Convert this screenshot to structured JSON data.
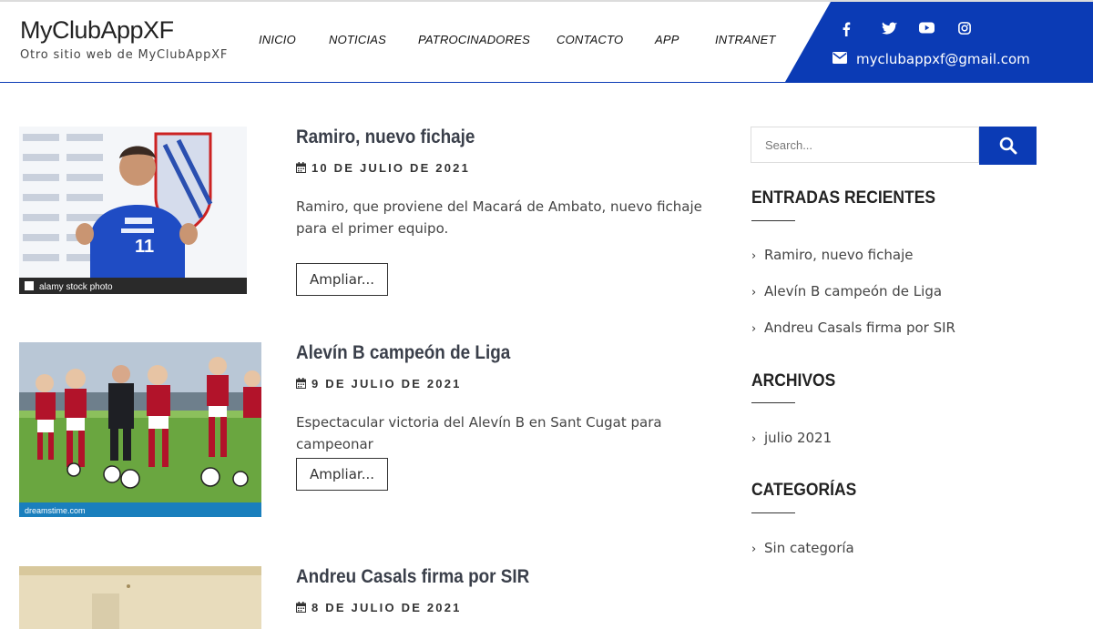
{
  "site": {
    "title": "MyClubAppXF",
    "tagline": "Otro sitio web de MyClubAppXF"
  },
  "nav": [
    "INICIO",
    "NOTICIAS",
    "PATROCINADORES",
    "CONTACTO",
    "APP",
    "INTRANET"
  ],
  "social": [
    "facebook-icon",
    "twitter-icon",
    "youtube-icon",
    "instagram-icon"
  ],
  "contact": {
    "email": "myclubappxf@gmail.com"
  },
  "colors": {
    "brand_blue": "#0b3bb5"
  },
  "posts": [
    {
      "title": "Ramiro, nuevo fichaje",
      "date": "10 DE JULIO DE 2021",
      "excerpt": "Ramiro, que proviene del Macará de Ambato, nuevo fichaje para el primer equipo.",
      "button": "Ampliar...",
      "image_caption": "alamy stock photo"
    },
    {
      "title": "Alevín B campeón de Liga",
      "date": "9 DE JULIO DE 2021",
      "excerpt": "Espectacular victoria del Alevín B en Sant Cugat para campeonar",
      "button": "Ampliar...",
      "image_caption": "dreamstime.com"
    },
    {
      "title": "Andreu Casals firma por SIR",
      "date": "8 DE JULIO DE 2021"
    }
  ],
  "sidebar": {
    "search_placeholder": "Search...",
    "recent": {
      "title": "ENTRADAS RECIENTES",
      "items": [
        "Ramiro, nuevo fichaje",
        "Alevín B campeón de Liga",
        "Andreu Casals firma por SIR"
      ]
    },
    "archives": {
      "title": "ARCHIVOS",
      "items": [
        "julio 2021"
      ]
    },
    "categories": {
      "title": "CATEGORÍAS",
      "items": [
        "Sin categoría"
      ]
    }
  }
}
